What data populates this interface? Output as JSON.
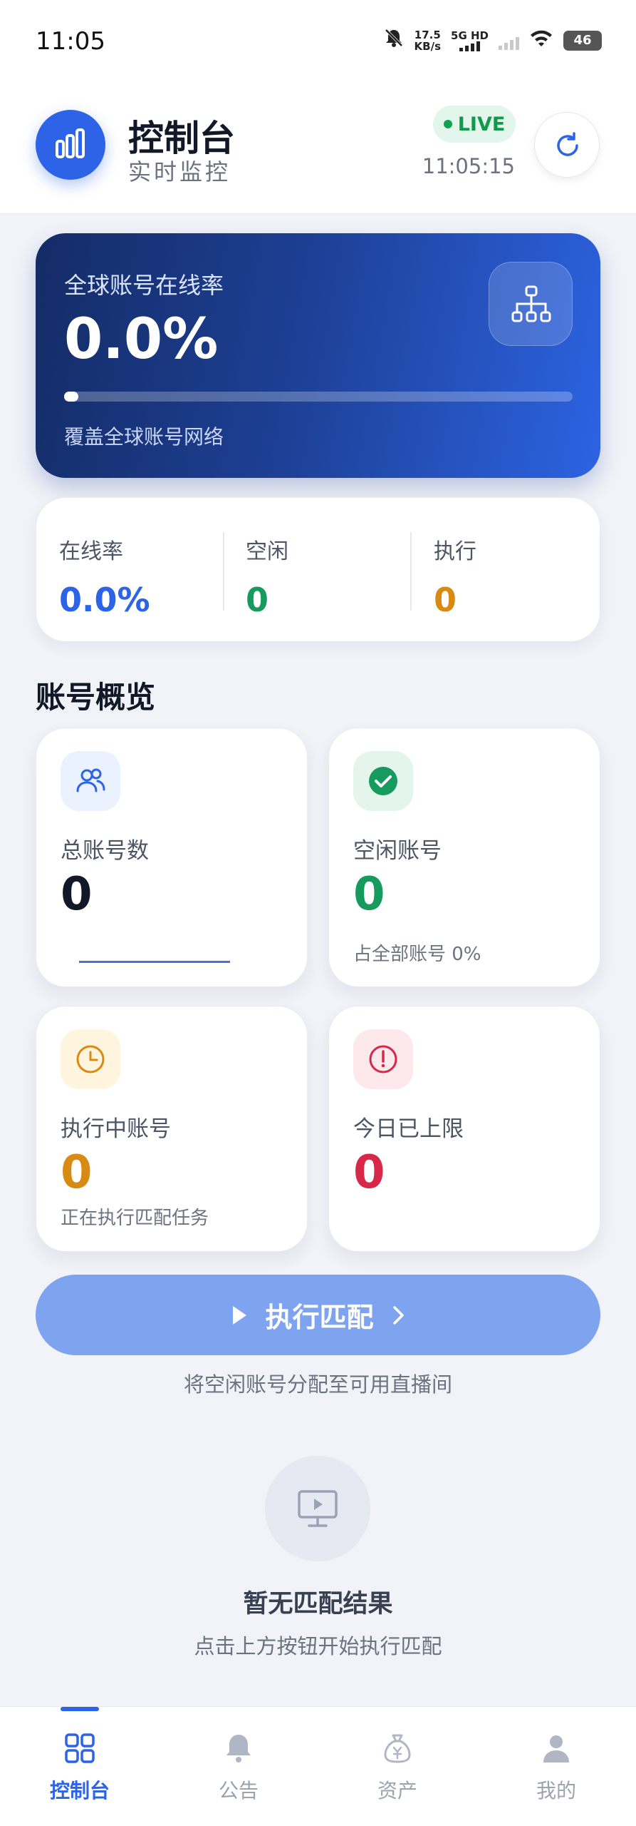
{
  "status_bar": {
    "time": "11:05",
    "net_speed_value": "17.5",
    "net_speed_unit": "KB/s",
    "network_type": "5G HD",
    "battery": "46",
    "icons": [
      "mute-bell-icon",
      "signal-icon",
      "wifi-icon",
      "battery-icon"
    ]
  },
  "header": {
    "title": "控制台",
    "subtitle": "实时监控",
    "live_label": "LIVE",
    "clock": "11:05:15"
  },
  "hero": {
    "label": "全球账号在线率",
    "value": "0.0%",
    "progress_fraction": 0.0,
    "caption": "覆盖全球账号网络"
  },
  "stats": [
    {
      "label": "在线率",
      "value": "0.0%",
      "color": "#2d63e6"
    },
    {
      "label": "空闲",
      "value": "0",
      "color": "#169a5d"
    },
    {
      "label": "执行",
      "value": "0",
      "color": "#d98a12"
    }
  ],
  "overview": {
    "title": "账号概览",
    "cards": [
      {
        "label": "总账号数",
        "value": "0",
        "note": "",
        "color": "#111827",
        "icon": "users-icon"
      },
      {
        "label": "空闲账号",
        "value": "0",
        "note": "占全部账号 0%",
        "color": "#169a5d",
        "icon": "check-circle-icon"
      },
      {
        "label": "执行中账号",
        "value": "0",
        "note": "正在执行匹配任务",
        "color": "#d98a12",
        "icon": "clock-icon"
      },
      {
        "label": "今日已上限",
        "value": "0",
        "note": "",
        "color": "#d8284a",
        "icon": "alert-icon"
      }
    ]
  },
  "action": {
    "label": "执行匹配",
    "hint": "将空闲账号分配至可用直播间"
  },
  "empty": {
    "title": "暂无匹配结果",
    "subtitle": "点击上方按钮开始执行匹配"
  },
  "nav": {
    "items": [
      {
        "label": "控制台",
        "icon": "grid-icon",
        "active": true
      },
      {
        "label": "公告",
        "icon": "bell-icon",
        "active": false
      },
      {
        "label": "资产",
        "icon": "money-bag-icon",
        "active": false
      },
      {
        "label": "我的",
        "icon": "user-icon",
        "active": false
      }
    ]
  },
  "colors": {
    "accent": "#2d63e6",
    "success": "#169a5d",
    "warning": "#d98a12",
    "danger": "#d8284a"
  }
}
